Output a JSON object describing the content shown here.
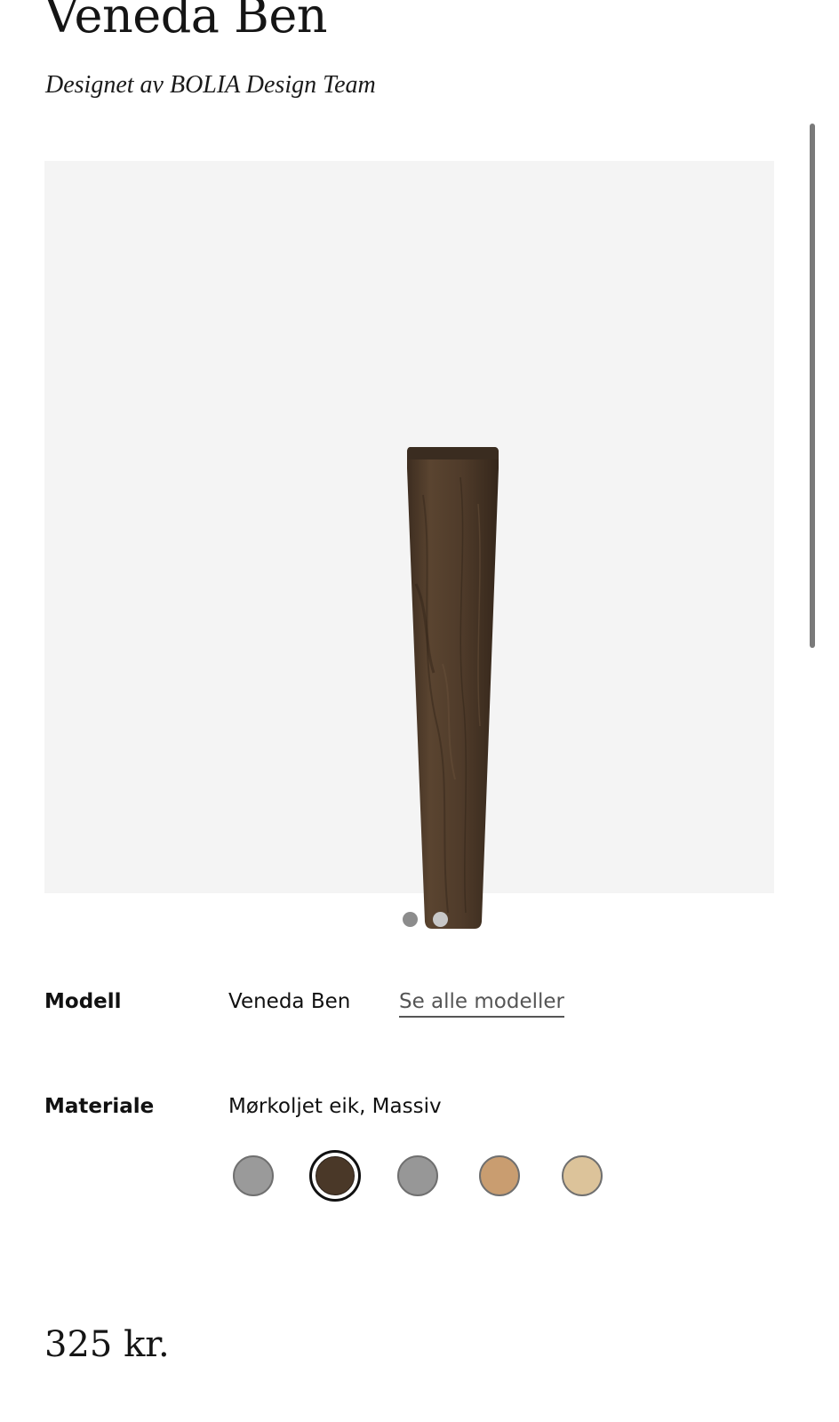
{
  "product": {
    "title": "Veneda Ben",
    "designer": "Designet av BOLIA Design Team"
  },
  "gallery": {
    "image": "wooden-furniture-leg",
    "image_color": "#4e3b2a",
    "dots": [
      true,
      false
    ]
  },
  "model": {
    "label": "Modell",
    "value": "Veneda Ben",
    "link": "Se alle modeller"
  },
  "material": {
    "label": "Materiale",
    "value": "Mørkoljet eik, Massiv",
    "swatches": [
      {
        "color": "#9a9a9a",
        "selected": false
      },
      {
        "color": "#4a3828",
        "selected": true
      },
      {
        "color": "#979797",
        "selected": false
      },
      {
        "color": "#c99d70",
        "selected": false
      },
      {
        "color": "#dcc39a",
        "selected": false
      }
    ]
  },
  "price": "325 kr."
}
